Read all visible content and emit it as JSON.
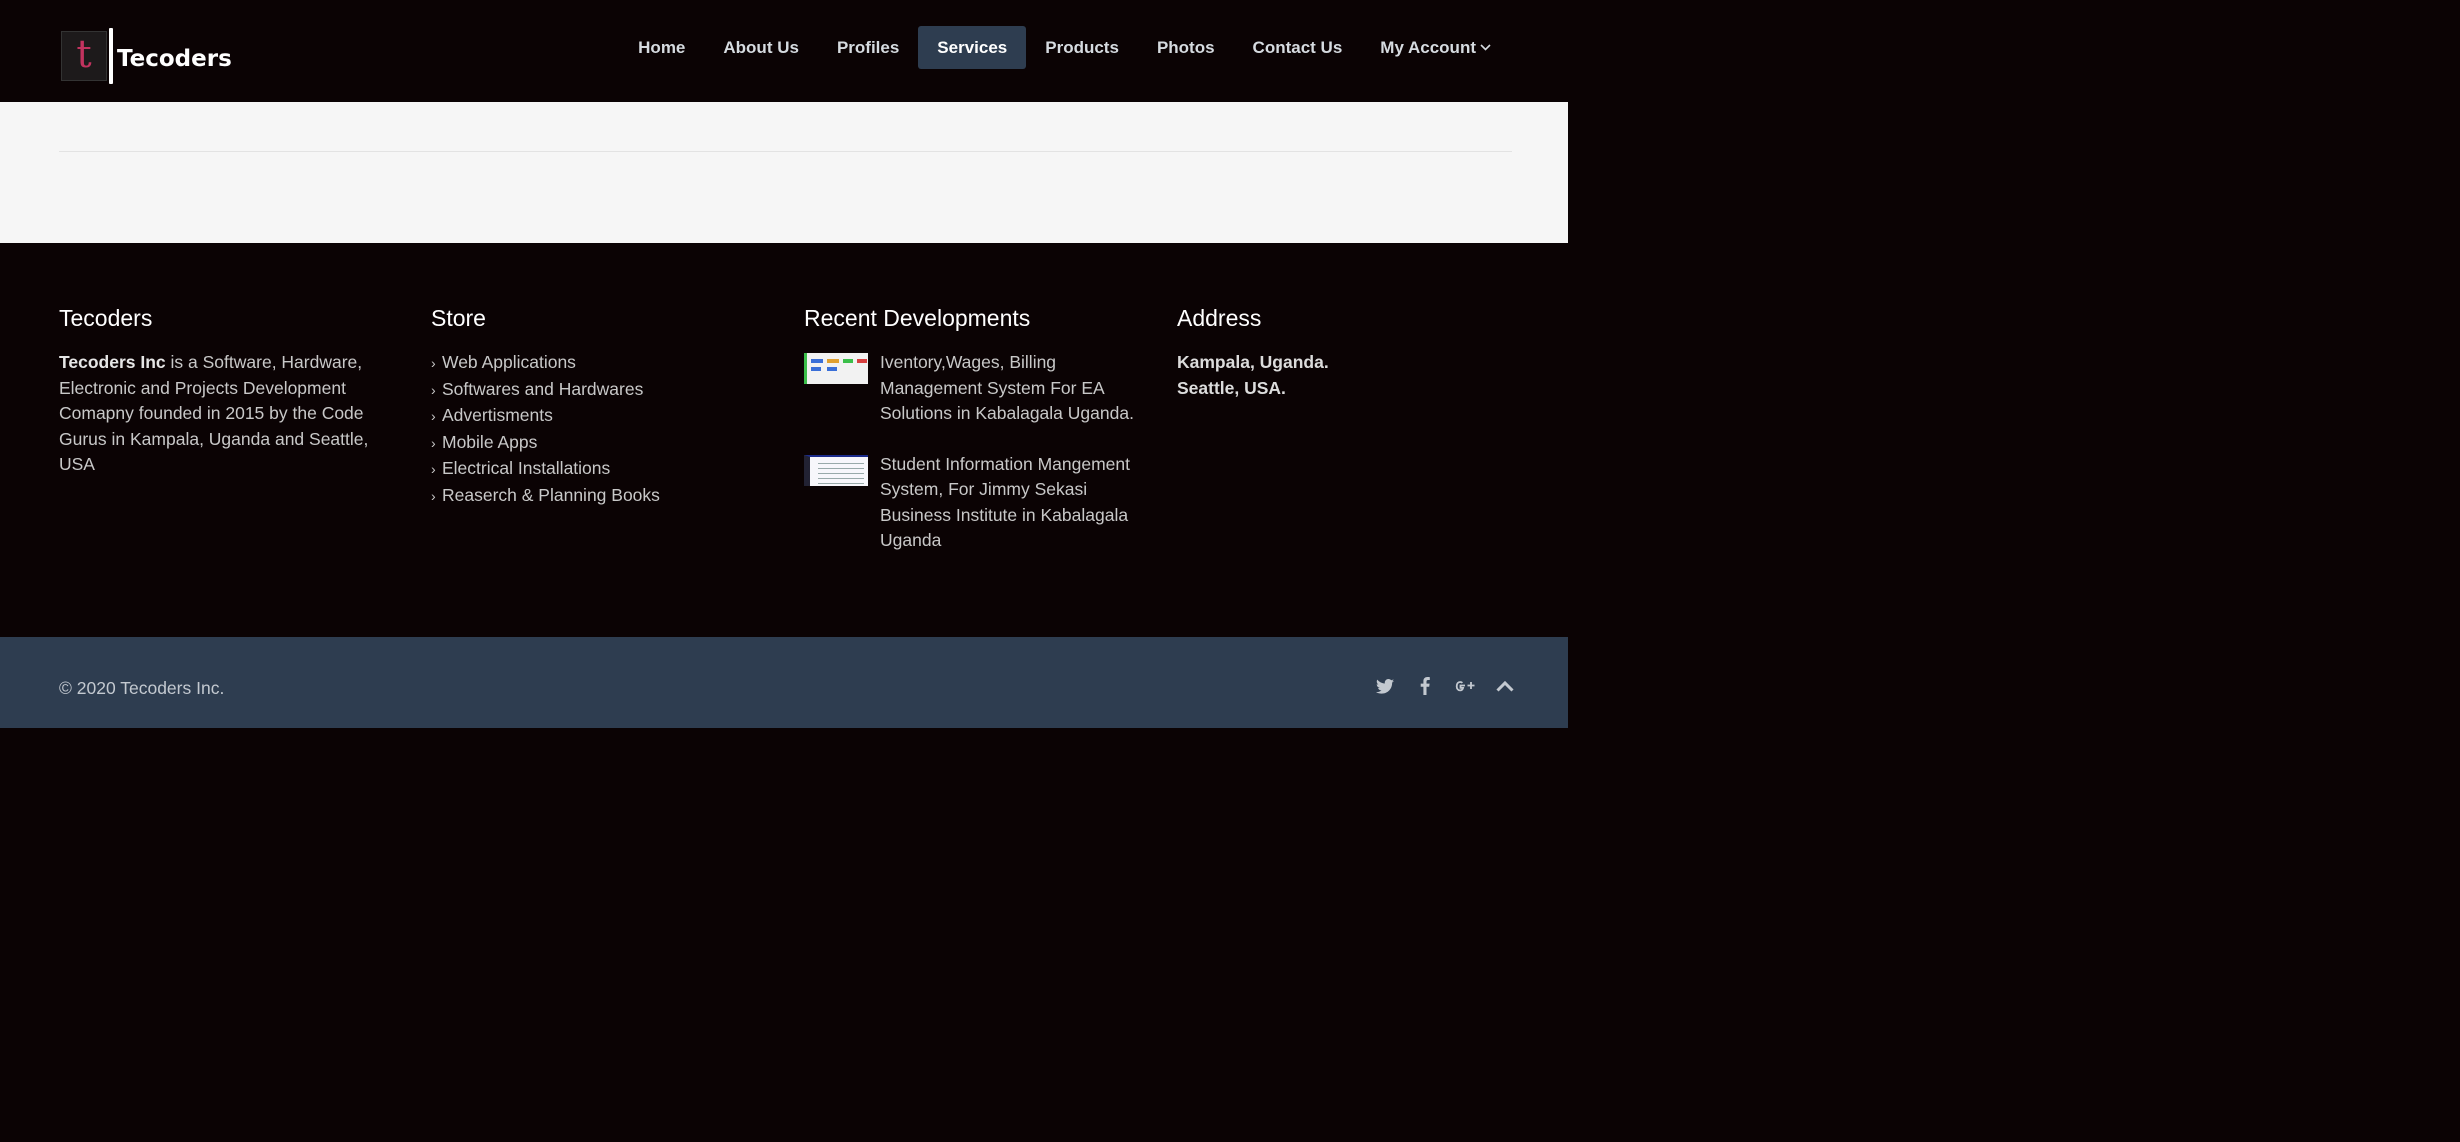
{
  "brand": {
    "logo_letter": "t",
    "name": "Tecoders"
  },
  "nav": {
    "items": [
      {
        "label": "Home"
      },
      {
        "label": "About Us"
      },
      {
        "label": "Profiles"
      },
      {
        "label": "Services"
      },
      {
        "label": "Products"
      },
      {
        "label": "Photos"
      },
      {
        "label": "Contact Us"
      },
      {
        "label": "My Account"
      }
    ],
    "active": "Services"
  },
  "footer": {
    "about": {
      "title": "Tecoders",
      "company": "Tecoders Inc",
      "text": " is a Software, Hardware, Electronic and Projects Development Comapny founded in 2015 by the Code Gurus in Kampala, Uganda and Seattle, USA"
    },
    "store": {
      "title": "Store",
      "items": [
        "Web Applications",
        "Softwares and Hardwares",
        "Advertisments",
        "Mobile Apps",
        "Electrical Installations",
        "Reaserch & Planning Books"
      ]
    },
    "recent": {
      "title": "Recent Developments",
      "items": [
        "Iventory,Wages, Billing Management System For EA Solutions in Kabalagala Uganda.",
        "Student Information Mangement System, For Jimmy Sekasi Business Institute in Kabalagala Uganda"
      ]
    },
    "address": {
      "title": "Address",
      "lines": [
        "Kampala, Uganda.",
        "Seattle, USA."
      ]
    }
  },
  "bottom": {
    "copyright": "© 2020 Tecoders Inc.",
    "social_icons": [
      "twitter-icon",
      "facebook-icon",
      "google-plus-icon",
      "scroll-top-icon"
    ]
  },
  "colors": {
    "header_bg": "#0b0304",
    "active_nav_bg": "#2e3d50",
    "bottom_bar_bg": "#2e3d50",
    "logo_accent": "#c2335f"
  }
}
